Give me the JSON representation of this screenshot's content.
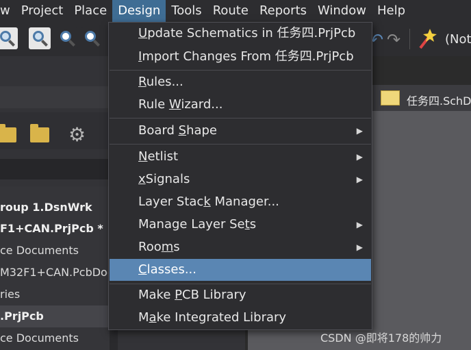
{
  "menubar": {
    "items": [
      {
        "label": "w"
      },
      {
        "label": "Project"
      },
      {
        "label": "Place"
      },
      {
        "label": "Design",
        "active": true
      },
      {
        "label": "Tools"
      },
      {
        "label": "Route"
      },
      {
        "label": "Reports"
      },
      {
        "label": "Window"
      },
      {
        "label": "Help"
      }
    ]
  },
  "toolbar": {
    "truncated_text": "(Not",
    "icons": [
      "zoom-fit-icon",
      "zoom-document-icon",
      "zoom-in-icon",
      "zoom-selected-icon",
      "undo-icon",
      "redo-icon",
      "magic-wand-icon"
    ]
  },
  "design_menu": {
    "items": [
      {
        "label": "Update Schematics in 任务四.PrjPcb",
        "hotkey": "U",
        "submenu": false
      },
      {
        "label": "Import Changes From 任务四.PrjPcb",
        "hotkey": "I",
        "submenu": false
      },
      {
        "label": "Rules...",
        "hotkey": "R",
        "submenu": false
      },
      {
        "label": "Rule Wizard...",
        "hotkey": "W",
        "submenu": false
      },
      {
        "label": "Board Shape",
        "hotkey": "S",
        "submenu": true
      },
      {
        "label": "Netlist",
        "hotkey": "N",
        "submenu": true
      },
      {
        "label": "xSignals",
        "hotkey": "x",
        "submenu": true
      },
      {
        "label": "Layer Stack Manager...",
        "hotkey": "k",
        "submenu": false
      },
      {
        "label": "Manage Layer Sets",
        "hotkey": "t",
        "submenu": true
      },
      {
        "label": "Rooms",
        "hotkey": "m",
        "submenu": true
      },
      {
        "label": "Classes...",
        "hotkey": "C",
        "submenu": false,
        "highlighted": true
      },
      {
        "label": "Make PCB Library",
        "hotkey": "P",
        "submenu": false
      },
      {
        "label": "Make Integrated Library",
        "hotkey": "a",
        "submenu": false
      }
    ]
  },
  "project_panel": {
    "tree": [
      {
        "label": "roup 1.DsnWrk",
        "bold": true
      },
      {
        "label": "F1+CAN.PrjPcb *",
        "bold": true
      },
      {
        "label": "ce Documents",
        "bold": false
      },
      {
        "label": "M32F1+CAN.PcbDoc",
        "bold": false
      },
      {
        "label": "ries",
        "bold": false
      },
      {
        "label": ".PrjPcb",
        "bold": true,
        "selected": true
      },
      {
        "label": "ce Documents",
        "bold": false
      }
    ]
  },
  "document_tab": {
    "label": "任务四.SchDo"
  },
  "watermark": "CSDN @即将178的帅力",
  "colors": {
    "menubar_bg": "#2d2d30",
    "active_menu": "#3f6d94",
    "highlight": "#5a86b3",
    "canvas": "#5a5a5e"
  }
}
